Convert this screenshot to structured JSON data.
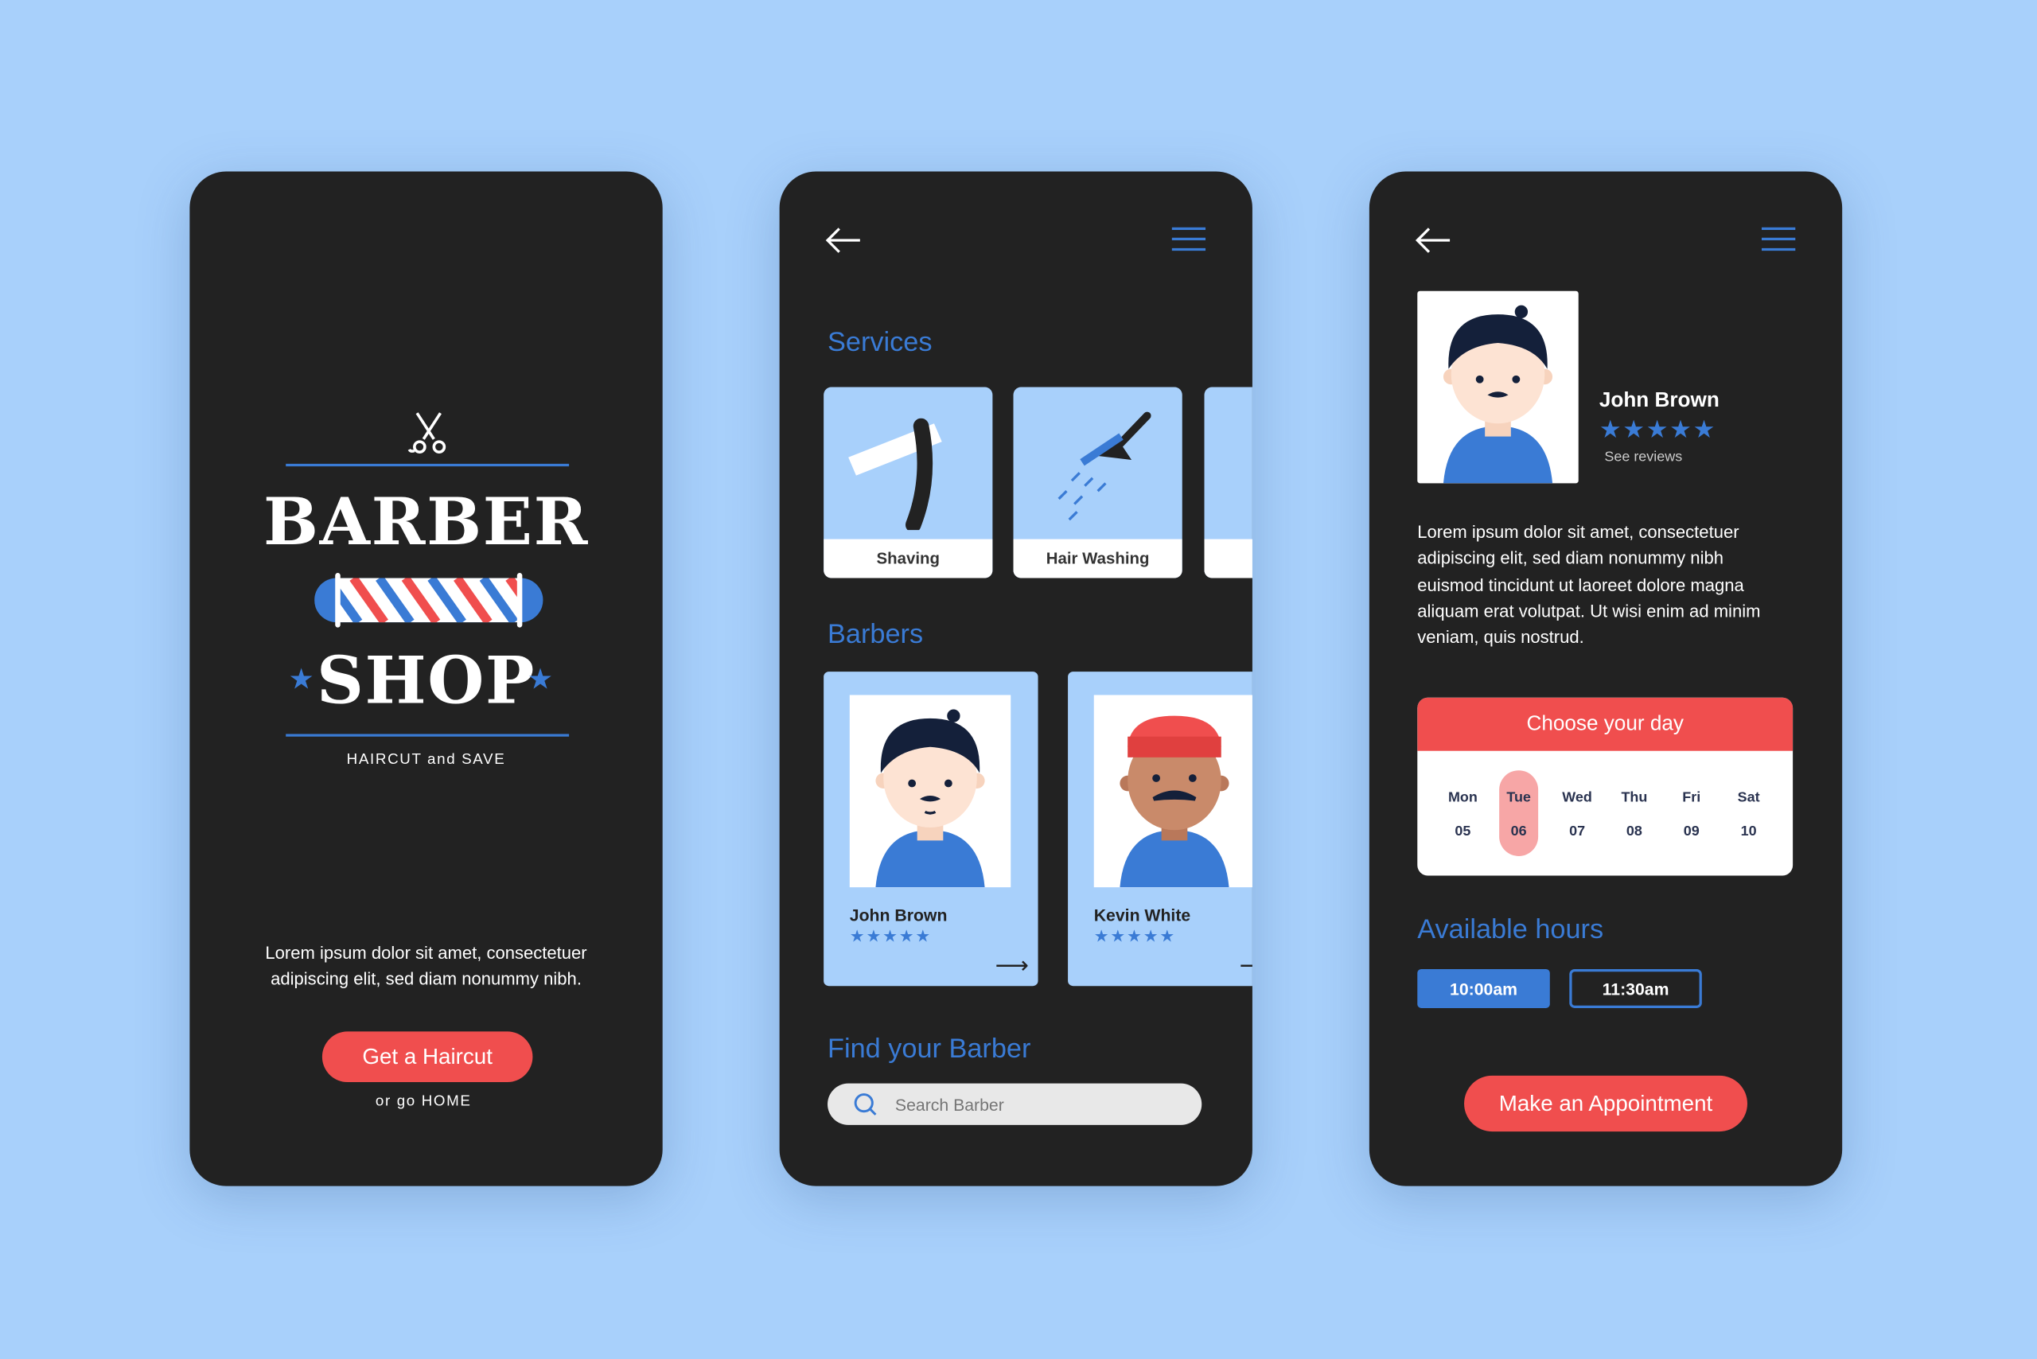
{
  "colors": {
    "background": "#a8d0fb",
    "phone": "#222222",
    "accent_blue": "#3a7bd5",
    "accent_red": "#f04e4e",
    "selected_day": "#f7a6a6"
  },
  "screen1": {
    "logo_line1": "BARBER",
    "logo_line2": "SHOP",
    "tagline": "HAIRCUT and SAVE",
    "description": "Lorem ipsum dolor sit amet, consectetuer adipiscing elit, sed diam nonummy nibh.",
    "cta": "Get a Haircut",
    "secondary_link": "or go HOME"
  },
  "screen2": {
    "services_title": "Services",
    "services": [
      {
        "label": "Shaving",
        "icon": "razor-icon"
      },
      {
        "label": "Hair Washing",
        "icon": "shower-icon"
      }
    ],
    "barbers_title": "Barbers",
    "barbers": [
      {
        "name": "John Brown",
        "rating": 5,
        "stars": "★★★★★"
      },
      {
        "name": "Kevin White",
        "rating": 5,
        "stars": "★★★★★"
      }
    ],
    "find_title": "Find your Barber",
    "search_placeholder": "Search Barber"
  },
  "screen3": {
    "name": "John Brown",
    "rating": 5,
    "stars": "★★★★★",
    "see_reviews": "See reviews",
    "bio": "Lorem ipsum dolor sit amet, consectetuer adipiscing elit, sed diam nonummy nibh euismod tincidunt ut laoreet dolore magna aliquam erat volutpat. Ut wisi enim ad minim veniam, quis nostrud.",
    "calendar_title": "Choose your day",
    "days": [
      {
        "day": "Mon",
        "date": "05"
      },
      {
        "day": "Tue",
        "date": "06",
        "selected": true
      },
      {
        "day": "Wed",
        "date": "07"
      },
      {
        "day": "Thu",
        "date": "08"
      },
      {
        "day": "Fri",
        "date": "09"
      },
      {
        "day": "Sat",
        "date": "10"
      }
    ],
    "hours_title": "Available hours",
    "hours": [
      {
        "label": "10:00am",
        "selected": true
      },
      {
        "label": "11:30am"
      }
    ],
    "cta": "Make an Appointment"
  }
}
